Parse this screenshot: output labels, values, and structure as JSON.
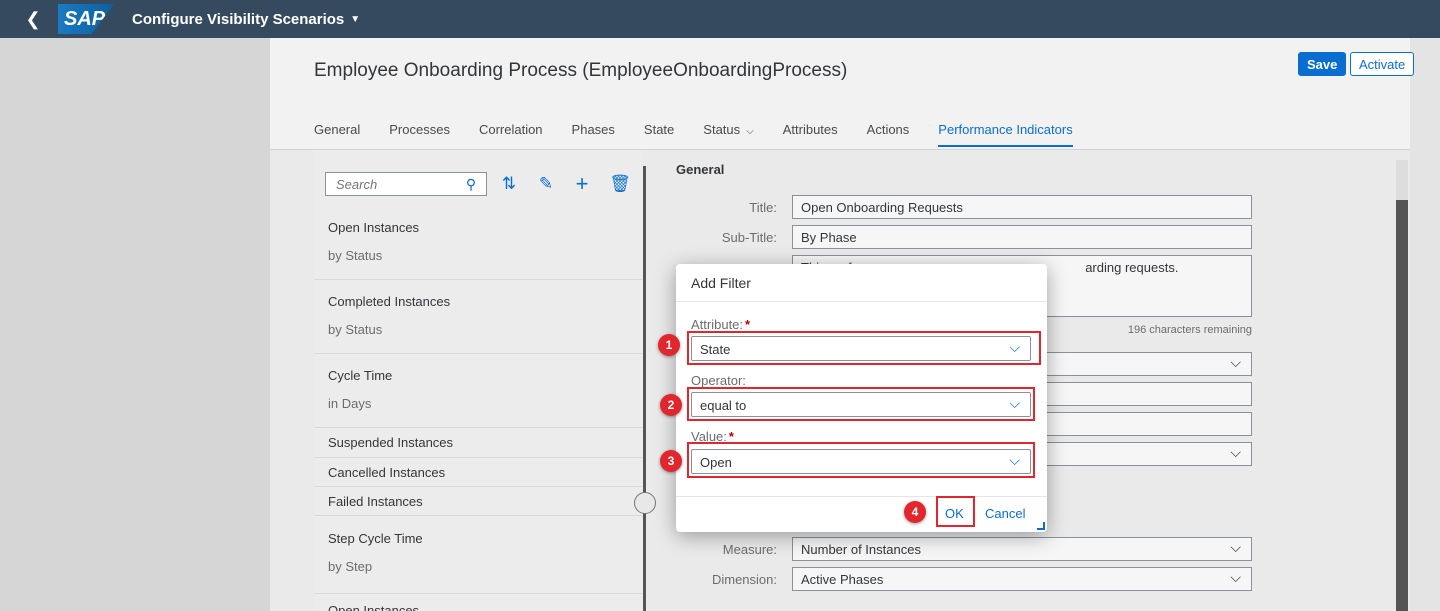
{
  "shell": {
    "app_title": "Configure Visibility Scenarios",
    "logo_text": "SAP"
  },
  "header": {
    "title": "Employee Onboarding Process (EmployeeOnboardingProcess)",
    "save_label": "Save",
    "activate_label": "Activate",
    "tabs": [
      {
        "label": "General"
      },
      {
        "label": "Processes"
      },
      {
        "label": "Correlation"
      },
      {
        "label": "Phases"
      },
      {
        "label": "State"
      },
      {
        "label": "Status"
      },
      {
        "label": "Attributes"
      },
      {
        "label": "Actions"
      },
      {
        "label": "Performance Indicators"
      }
    ]
  },
  "list": {
    "search_placeholder": "Search",
    "items": [
      {
        "title": "Open Instances",
        "subtitle": "by Status"
      },
      {
        "title": "Completed Instances",
        "subtitle": "by Status"
      },
      {
        "title": "Cycle Time",
        "subtitle": "in Days"
      },
      {
        "title": "Suspended Instances"
      },
      {
        "title": "Cancelled Instances"
      },
      {
        "title": "Failed Instances"
      },
      {
        "title": "Step Cycle Time",
        "subtitle": "by Step"
      },
      {
        "title": "Open Instances"
      }
    ]
  },
  "form": {
    "heading": "General",
    "title_label": "Title:",
    "title_value": "Open Onboarding Requests",
    "subtitle_label": "Sub-Title:",
    "subtitle_value": "By Phase",
    "description_partial_left": "This perf",
    "description_partial_right": "arding requests.",
    "remaining": "196 characters remaining",
    "measure_label": "Measure:",
    "measure_value": "Number of Instances",
    "dimension_label": "Dimension:",
    "dimension_value": "Active Phases"
  },
  "dialog": {
    "title": "Add Filter",
    "attribute_label": "Attribute:",
    "attribute_value": "State",
    "operator_label": "Operator:",
    "operator_value": "equal to",
    "value_label": "Value:",
    "value_value": "Open",
    "ok_label": "OK",
    "cancel_label": "Cancel",
    "steps": [
      "1",
      "2",
      "3",
      "4"
    ],
    "required_marker": "*"
  },
  "colors": {
    "shell_bg": "#354a5f",
    "accent": "#0a6ed1",
    "highlight": "#e2262d"
  }
}
